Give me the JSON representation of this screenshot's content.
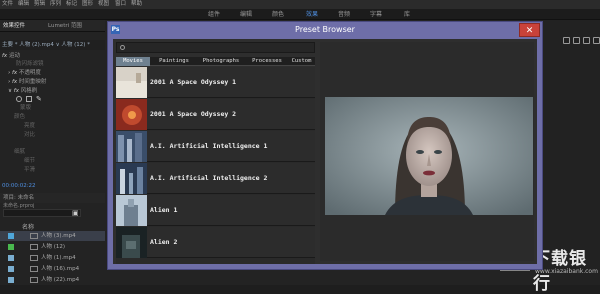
{
  "menubar": {
    "items": [
      "文件",
      "编辑",
      "剪辑",
      "序列",
      "标记",
      "图形",
      "视图",
      "窗口",
      "帮助"
    ]
  },
  "workspace": {
    "tabs": [
      "组件",
      "编辑",
      "颜色",
      "效果",
      "音频",
      "字幕",
      "库"
    ],
    "active": "效果"
  },
  "panel": {
    "tab_effects": "效果控件",
    "tab_lumetri": "Lumetri 范围",
    "clip_header": "主要 * 人物 (2).mp4 ∨ 人物 (12) *",
    "tree": [
      {
        "label": "运动",
        "type": "fx"
      },
      {
        "label": "防闪烁滤镜",
        "type": "dim"
      },
      {
        "label": "不透明度",
        "type": "fx"
      },
      {
        "label": "时间重映射",
        "type": "fx"
      },
      {
        "label": "风格刷",
        "type": "fx"
      },
      {
        "label": "蒙版",
        "type": "dim"
      },
      {
        "label": "颜色",
        "type": "dim"
      },
      {
        "label": "亮度",
        "type": "dim"
      },
      {
        "label": "对比",
        "type": "dim"
      },
      {
        "label": "细腻",
        "type": "dim"
      },
      {
        "label": "细节",
        "type": "dim"
      },
      {
        "label": "平滑",
        "type": "dim"
      }
    ],
    "timecode": "00:00:02:22"
  },
  "project": {
    "tab": "项目: 未命名",
    "file": "未命名.prproj",
    "name_col": "名称",
    "items": [
      {
        "label": "人物 (3).mp4",
        "color": "#4fa6d9",
        "selected": true
      },
      {
        "label": "人物 (12)",
        "color": "#49b84e",
        "selected": false
      },
      {
        "label": "人物 (1).mp4",
        "color": "#7aaed0",
        "selected": false
      },
      {
        "label": "人物 (16).mp4",
        "color": "#7aaed0",
        "selected": false
      },
      {
        "label": "人物 (22).mp4",
        "color": "#7aaed0",
        "selected": false
      }
    ]
  },
  "dialog": {
    "title": "Preset Browser",
    "close_label": "✕",
    "search": {
      "value": "",
      "placeholder": ""
    },
    "tabs": [
      "Movies",
      "Paintings",
      "Photographs",
      "Processes",
      "Custom"
    ],
    "active_tab": "Movies",
    "presets": [
      {
        "label": "2001 A Space Odyssey 1",
        "thumb": "odyssey1"
      },
      {
        "label": "2001 A Space Odyssey 2",
        "thumb": "odyssey2"
      },
      {
        "label": "A.I. Artificial Intelligence 1",
        "thumb": "ai1"
      },
      {
        "label": "A.I. Artificial Intelligence 2",
        "thumb": "ai2"
      },
      {
        "label": "Alien 1",
        "thumb": "alien1"
      },
      {
        "label": "Alien 2",
        "thumb": "alien2"
      }
    ]
  },
  "watermark": {
    "title": "下载银行",
    "url": "www.xiazaibank.com"
  },
  "colors": {
    "dialog_frame": "#6e6ea8",
    "accent": "#4f8fe0",
    "tab_active": "#6f8190",
    "close": "#c9423a"
  }
}
